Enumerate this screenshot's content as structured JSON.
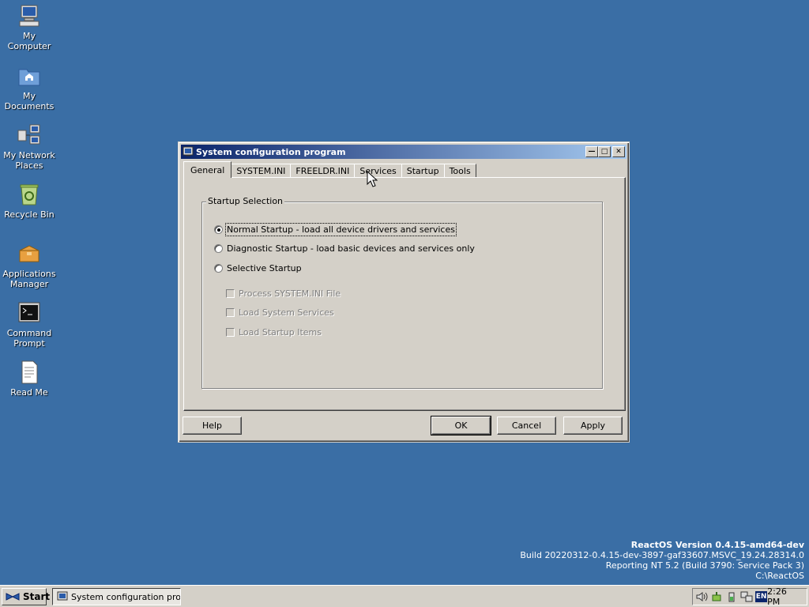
{
  "desktop": {
    "icons": [
      {
        "label": "My Computer",
        "icon": "computer-icon"
      },
      {
        "label": "My Documents",
        "icon": "folder-documents-icon"
      },
      {
        "label": "My Network Places",
        "icon": "network-places-icon"
      },
      {
        "label": "Recycle Bin",
        "icon": "recycle-bin-icon"
      },
      {
        "label": "Applications Manager",
        "icon": "applications-manager-icon"
      },
      {
        "label": "Command Prompt",
        "icon": "command-prompt-icon"
      },
      {
        "label": "Read Me",
        "icon": "document-icon"
      }
    ],
    "background_color": "#3a6ea5"
  },
  "window": {
    "title": "System configuration program",
    "tabs": [
      {
        "label": "General",
        "active": true
      },
      {
        "label": "SYSTEM.INI",
        "active": false
      },
      {
        "label": "FREELDR.INI",
        "active": false
      },
      {
        "label": "Services",
        "active": false
      },
      {
        "label": "Startup",
        "active": false
      },
      {
        "label": "Tools",
        "active": false
      }
    ],
    "group_title": "Startup Selection",
    "radios": [
      {
        "label": "Normal Startup - load all device drivers and services",
        "selected": true
      },
      {
        "label": "Diagnostic Startup - load basic devices and services only",
        "selected": false
      },
      {
        "label": "Selective Startup",
        "selected": false
      }
    ],
    "checkboxes": [
      {
        "label": "Process SYSTEM.INI File",
        "checked": false,
        "enabled": false
      },
      {
        "label": "Load System Services",
        "checked": false,
        "enabled": false
      },
      {
        "label": "Load Startup Items",
        "checked": false,
        "enabled": false
      }
    ],
    "buttons": {
      "help": "Help",
      "ok": "OK",
      "cancel": "Cancel",
      "apply": "Apply"
    }
  },
  "version_info": {
    "line1": "ReactOS Version 0.4.15-amd64-dev",
    "line2": "Build 20220312-0.4.15-dev-3897-gaf33607.MSVC_19.24.28314.0",
    "line3": "Reporting NT 5.2 (Build 3790: Service Pack 3)",
    "line4": "C:\\ReactOS"
  },
  "taskbar": {
    "start_label": "Start",
    "task_label": "System configuration progr...",
    "language": "EN",
    "clock": "2:26 PM"
  }
}
